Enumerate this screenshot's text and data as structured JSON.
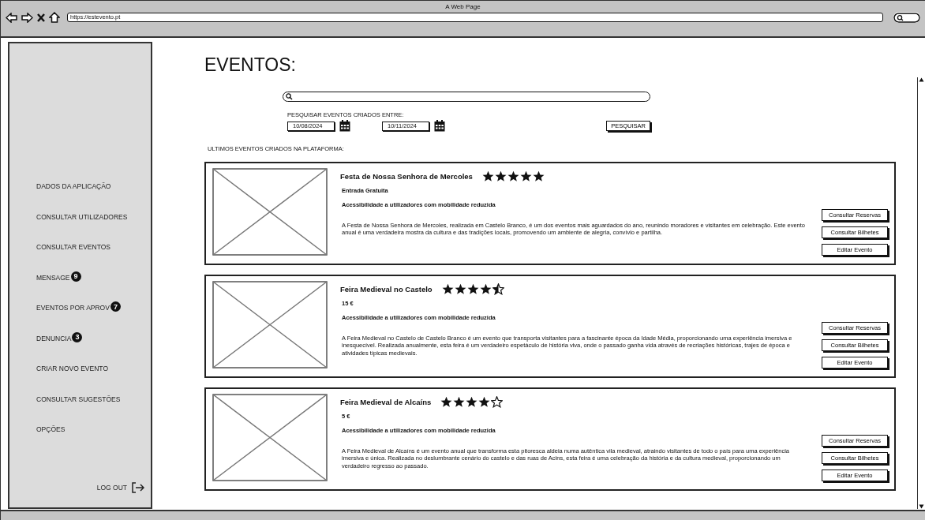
{
  "window": {
    "title": "A Web Page",
    "address": "https://estevento.pt"
  },
  "sidebar": {
    "items": [
      {
        "label": "DADOS DA APLICAÇÃO"
      },
      {
        "label": "CONSULTAR UTILIZADORES"
      },
      {
        "label": "CONSULTAR EVENTOS"
      },
      {
        "label": "MENSAGE",
        "badge": "9"
      },
      {
        "label": "EVENTOS POR APROV",
        "badge": "7"
      },
      {
        "label": "DENUNCIA",
        "badge": "3"
      },
      {
        "label": "CRIAR NOVO EVENTO"
      },
      {
        "label": "CONSULTAR SUGESTÕES"
      },
      {
        "label": "OPÇÕES"
      }
    ],
    "logout": "LOG OUT"
  },
  "heading": "EVENTOS:",
  "filter": {
    "label": "PESQUISAR EVENTOS CRIADOS ENTRE:",
    "date_from": "10/08/2024",
    "date_to": "10/11/2024",
    "button": "PESQUISAR"
  },
  "list_title": "ULTIMOS EVENTOS CRIADOS NA PLATAFORMA:",
  "events": [
    {
      "title": "Festa de Nossa Senhora de Mercoles",
      "stars": 5,
      "price": "Entrada Gratuita",
      "accessibility": "Acessibilidade a utilizadores com mobilidade reduzida",
      "description": "A Festa de Nossa Senhora de Mercoles, realizada em Castelo Branco, é um dos eventos mais aguardados do ano, reunindo moradores e visitantes em celebração. Este evento anual é uma verdadeira mostra da cultura e das tradições locais, promovendo um ambiente de alegria, convívio e partilha.",
      "buttons": [
        "Consultar Reservas",
        "Consultar Bilhetes",
        "Editar Evento"
      ]
    },
    {
      "title": "Feira Medieval no Castelo",
      "stars": 4.5,
      "price": "15 €",
      "accessibility": "Acessibilidade a utilizadores com mobilidade reduzida",
      "description": "A Feira Medieval no Castelo de Castelo Branco é um evento que transporta visitantes para a fascinante época da Idade Média, proporcionando uma experiência imersiva e inesquecível. Realizada anualmente, esta feira é um verdadeiro espetáculo de história viva, onde o passado ganha vida através de recriações históricas, trajes de época e atividades típicas medievais.",
      "buttons": [
        "Consultar Reservas",
        "Consultar Bilhetes",
        "Editar Evento"
      ]
    },
    {
      "title": "Feira Medieval de Alcaíns",
      "stars": 4,
      "price": "5 €",
      "accessibility": "Acessibilidade a utilizadores com mobilidade reduzida",
      "description": "A Feira Medieval de Alcaíns é um evento anual que transforma esta pitoresca aldeia numa autêntica vila medieval, atraindo visitantes de todo o país para uma experiência imersiva e única. Realizada no deslumbrante cenário do castelo e das ruas de Acins, esta feira é uma celebração da história e da cultura medieval, proporcionando um verdadeiro regresso ao passado.",
      "buttons": [
        "Consultar Reservas",
        "Consultar Bilhetes",
        "Editar Evento"
      ]
    }
  ]
}
